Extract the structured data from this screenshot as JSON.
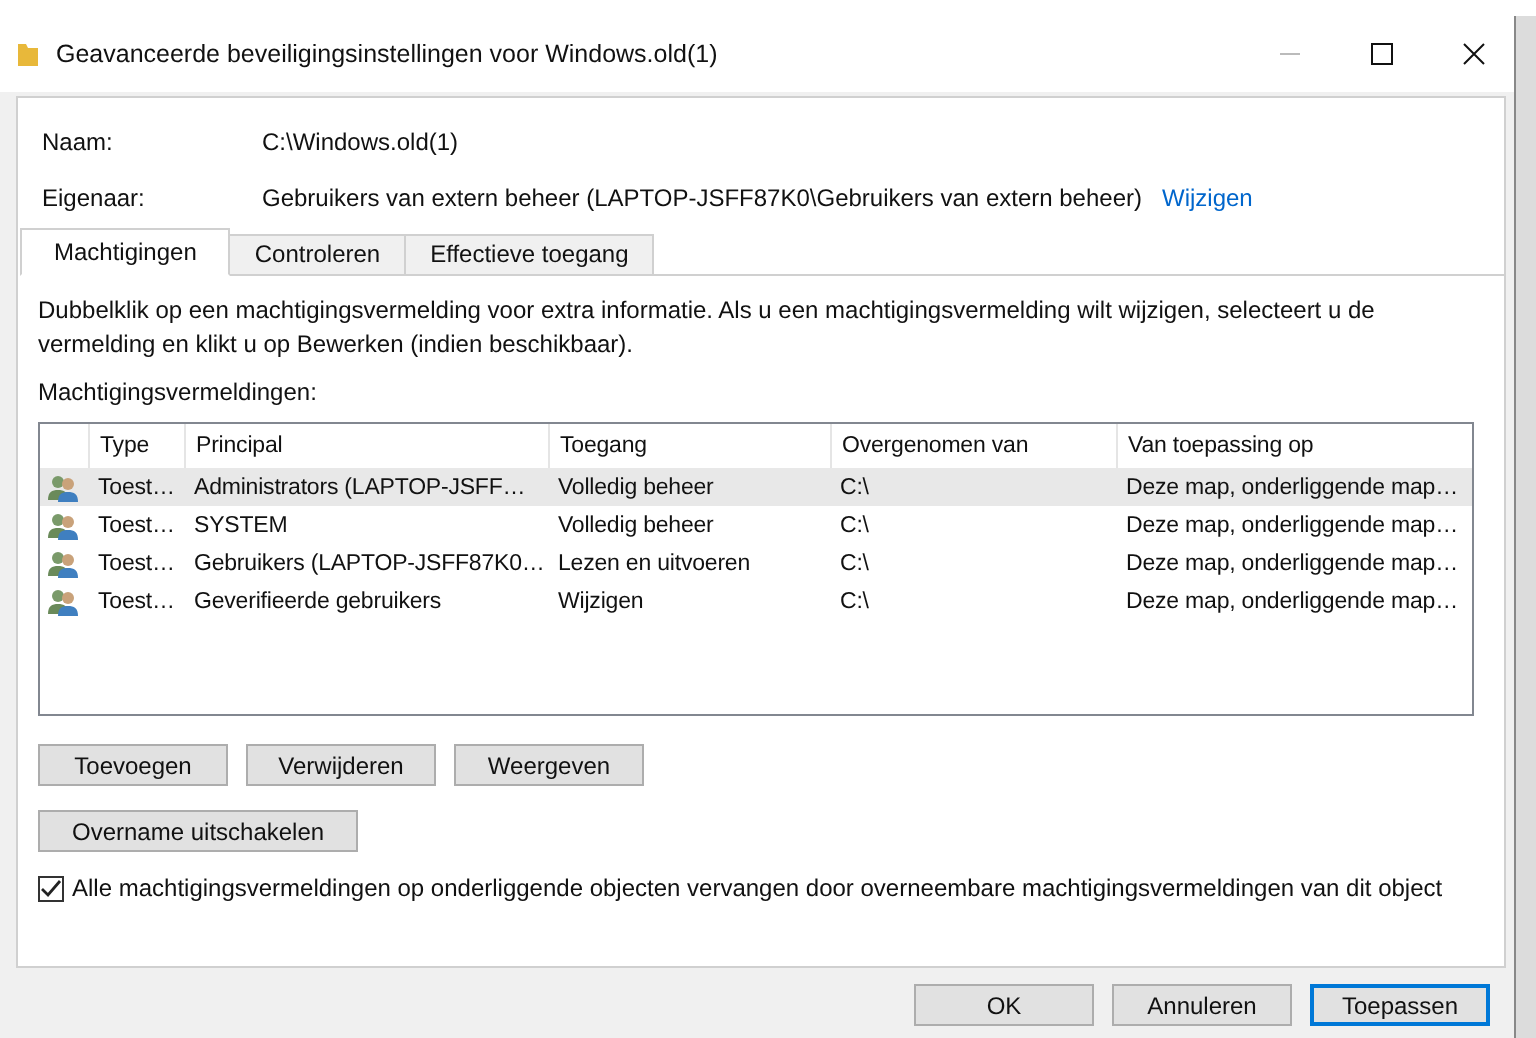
{
  "window": {
    "title": "Geavanceerde beveiligingsinstellingen voor Windows.old(1)"
  },
  "fields": [
    {
      "label": "Naam:",
      "value": "C:\\Windows.old(1)"
    },
    {
      "label": "Eigenaar:",
      "value": "Gebruikers van extern beheer (LAPTOP-JSFF87K0\\Gebruikers van extern beheer)",
      "link": "Wijzigen"
    }
  ],
  "tabs": [
    {
      "label": "Machtigingen",
      "selected": true
    },
    {
      "label": "Controleren",
      "selected": false
    },
    {
      "label": "Effectieve toegang",
      "selected": false
    }
  ],
  "description": "Dubbelklik op een machtigingsvermelding voor extra informatie. Als u een machtigingsvermelding wilt wijzigen, selecteert u de vermelding en klikt u op Bewerken (indien beschikbaar).",
  "table": {
    "label": "Machtigingsvermeldingen:",
    "columns": [
      "Type",
      "Principal",
      "Toegang",
      "Overgenomen van",
      "Van toepassing op"
    ],
    "rows": [
      {
        "selected": true,
        "cells": [
          "Toest…",
          "Administrators (LAPTOP-JSFF…",
          "Volledig beheer",
          "C:\\",
          "Deze map, onderliggende map…"
        ]
      },
      {
        "selected": false,
        "cells": [
          "Toest…",
          "SYSTEM",
          "Volledig beheer",
          "C:\\",
          "Deze map, onderliggende map…"
        ]
      },
      {
        "selected": false,
        "cells": [
          "Toest…",
          "Gebruikers (LAPTOP-JSFF87K0…",
          "Lezen en uitvoeren",
          "C:\\",
          "Deze map, onderliggende map…"
        ]
      },
      {
        "selected": false,
        "cells": [
          "Toest…",
          "Geverifieerde gebruikers",
          "Wijzigen",
          "C:\\",
          "Deze map, onderliggende map…"
        ]
      }
    ]
  },
  "entry_buttons": [
    "Toevoegen",
    "Verwijderen",
    "Weergeven"
  ],
  "inheritance_button": "Overname uitschakelen",
  "replace_checkbox": {
    "label": "Alle machtigingsvermeldingen op onderliggende objecten vervangen door overneembare machtigingsvermeldingen van dit object",
    "checked": true
  },
  "footer_buttons": [
    {
      "label": "OK",
      "default": false
    },
    {
      "label": "Annuleren",
      "default": false
    },
    {
      "label": "Toepassen",
      "default": true
    }
  ]
}
